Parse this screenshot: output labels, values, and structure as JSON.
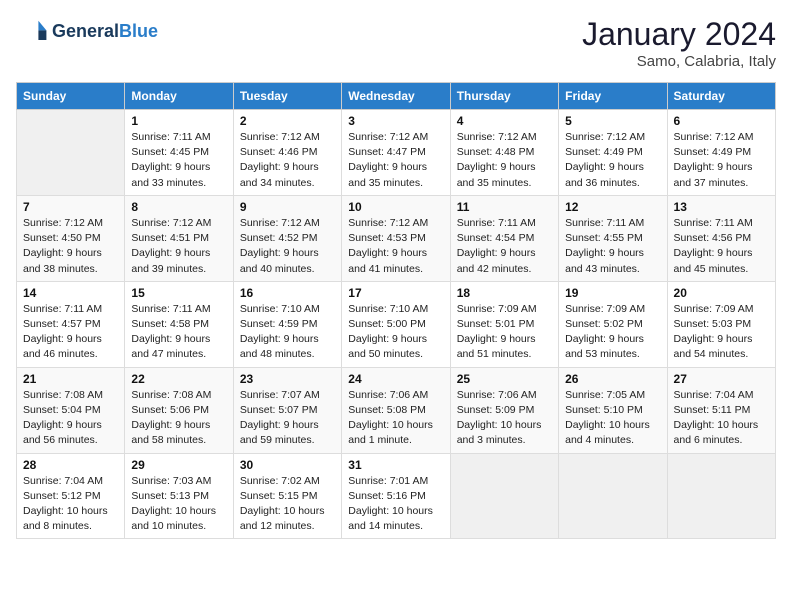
{
  "header": {
    "logo_line1": "General",
    "logo_line2": "Blue",
    "title": "January 2024",
    "subtitle": "Samo, Calabria, Italy"
  },
  "columns": [
    "Sunday",
    "Monday",
    "Tuesday",
    "Wednesday",
    "Thursday",
    "Friday",
    "Saturday"
  ],
  "weeks": [
    [
      {
        "num": "",
        "info": ""
      },
      {
        "num": "1",
        "info": "Sunrise: 7:11 AM\nSunset: 4:45 PM\nDaylight: 9 hours\nand 33 minutes."
      },
      {
        "num": "2",
        "info": "Sunrise: 7:12 AM\nSunset: 4:46 PM\nDaylight: 9 hours\nand 34 minutes."
      },
      {
        "num": "3",
        "info": "Sunrise: 7:12 AM\nSunset: 4:47 PM\nDaylight: 9 hours\nand 35 minutes."
      },
      {
        "num": "4",
        "info": "Sunrise: 7:12 AM\nSunset: 4:48 PM\nDaylight: 9 hours\nand 35 minutes."
      },
      {
        "num": "5",
        "info": "Sunrise: 7:12 AM\nSunset: 4:49 PM\nDaylight: 9 hours\nand 36 minutes."
      },
      {
        "num": "6",
        "info": "Sunrise: 7:12 AM\nSunset: 4:49 PM\nDaylight: 9 hours\nand 37 minutes."
      }
    ],
    [
      {
        "num": "7",
        "info": "Sunrise: 7:12 AM\nSunset: 4:50 PM\nDaylight: 9 hours\nand 38 minutes."
      },
      {
        "num": "8",
        "info": "Sunrise: 7:12 AM\nSunset: 4:51 PM\nDaylight: 9 hours\nand 39 minutes."
      },
      {
        "num": "9",
        "info": "Sunrise: 7:12 AM\nSunset: 4:52 PM\nDaylight: 9 hours\nand 40 minutes."
      },
      {
        "num": "10",
        "info": "Sunrise: 7:12 AM\nSunset: 4:53 PM\nDaylight: 9 hours\nand 41 minutes."
      },
      {
        "num": "11",
        "info": "Sunrise: 7:11 AM\nSunset: 4:54 PM\nDaylight: 9 hours\nand 42 minutes."
      },
      {
        "num": "12",
        "info": "Sunrise: 7:11 AM\nSunset: 4:55 PM\nDaylight: 9 hours\nand 43 minutes."
      },
      {
        "num": "13",
        "info": "Sunrise: 7:11 AM\nSunset: 4:56 PM\nDaylight: 9 hours\nand 45 minutes."
      }
    ],
    [
      {
        "num": "14",
        "info": "Sunrise: 7:11 AM\nSunset: 4:57 PM\nDaylight: 9 hours\nand 46 minutes."
      },
      {
        "num": "15",
        "info": "Sunrise: 7:11 AM\nSunset: 4:58 PM\nDaylight: 9 hours\nand 47 minutes."
      },
      {
        "num": "16",
        "info": "Sunrise: 7:10 AM\nSunset: 4:59 PM\nDaylight: 9 hours\nand 48 minutes."
      },
      {
        "num": "17",
        "info": "Sunrise: 7:10 AM\nSunset: 5:00 PM\nDaylight: 9 hours\nand 50 minutes."
      },
      {
        "num": "18",
        "info": "Sunrise: 7:09 AM\nSunset: 5:01 PM\nDaylight: 9 hours\nand 51 minutes."
      },
      {
        "num": "19",
        "info": "Sunrise: 7:09 AM\nSunset: 5:02 PM\nDaylight: 9 hours\nand 53 minutes."
      },
      {
        "num": "20",
        "info": "Sunrise: 7:09 AM\nSunset: 5:03 PM\nDaylight: 9 hours\nand 54 minutes."
      }
    ],
    [
      {
        "num": "21",
        "info": "Sunrise: 7:08 AM\nSunset: 5:04 PM\nDaylight: 9 hours\nand 56 minutes."
      },
      {
        "num": "22",
        "info": "Sunrise: 7:08 AM\nSunset: 5:06 PM\nDaylight: 9 hours\nand 58 minutes."
      },
      {
        "num": "23",
        "info": "Sunrise: 7:07 AM\nSunset: 5:07 PM\nDaylight: 9 hours\nand 59 minutes."
      },
      {
        "num": "24",
        "info": "Sunrise: 7:06 AM\nSunset: 5:08 PM\nDaylight: 10 hours\nand 1 minute."
      },
      {
        "num": "25",
        "info": "Sunrise: 7:06 AM\nSunset: 5:09 PM\nDaylight: 10 hours\nand 3 minutes."
      },
      {
        "num": "26",
        "info": "Sunrise: 7:05 AM\nSunset: 5:10 PM\nDaylight: 10 hours\nand 4 minutes."
      },
      {
        "num": "27",
        "info": "Sunrise: 7:04 AM\nSunset: 5:11 PM\nDaylight: 10 hours\nand 6 minutes."
      }
    ],
    [
      {
        "num": "28",
        "info": "Sunrise: 7:04 AM\nSunset: 5:12 PM\nDaylight: 10 hours\nand 8 minutes."
      },
      {
        "num": "29",
        "info": "Sunrise: 7:03 AM\nSunset: 5:13 PM\nDaylight: 10 hours\nand 10 minutes."
      },
      {
        "num": "30",
        "info": "Sunrise: 7:02 AM\nSunset: 5:15 PM\nDaylight: 10 hours\nand 12 minutes."
      },
      {
        "num": "31",
        "info": "Sunrise: 7:01 AM\nSunset: 5:16 PM\nDaylight: 10 hours\nand 14 minutes."
      },
      {
        "num": "",
        "info": ""
      },
      {
        "num": "",
        "info": ""
      },
      {
        "num": "",
        "info": ""
      }
    ]
  ]
}
